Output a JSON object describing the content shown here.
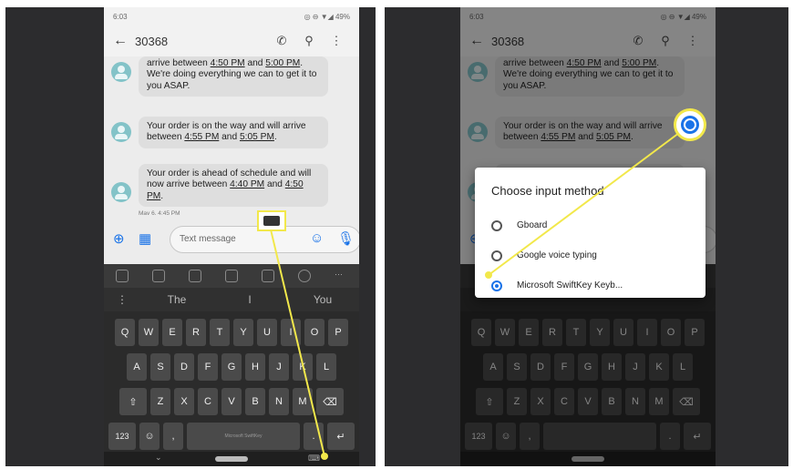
{
  "left": {
    "status": {
      "time": "6:03",
      "battery": "49%"
    },
    "appbar": {
      "title": "30368"
    },
    "messages": [
      {
        "lines": [
          "arrive between ",
          "4:50 PM",
          " and ",
          "5:00 PM",
          ". We're doing everything we can to get it to you ASAP."
        ]
      },
      {
        "lines": [
          "Your order is on the way and will arrive between ",
          "4:55 PM",
          " and ",
          "5:05 PM",
          "."
        ]
      },
      {
        "lines": [
          "Your order is ahead of schedule and will now arrive between ",
          "4:40 PM",
          " and ",
          "4:50 PM",
          "."
        ]
      }
    ],
    "timestamp": "May 6, 4:45 PM",
    "composer": {
      "placeholder": "Text message"
    },
    "suggestions": [
      "The",
      "I",
      "You"
    ],
    "rows": [
      [
        "Q",
        "W",
        "E",
        "R",
        "T",
        "Y",
        "U",
        "I",
        "O",
        "P"
      ],
      [
        "A",
        "S",
        "D",
        "F",
        "G",
        "H",
        "J",
        "K",
        "L"
      ],
      [
        "Z",
        "X",
        "C",
        "V",
        "B",
        "N",
        "M"
      ]
    ],
    "space_label": "Microsoft SwiftKey",
    "num_key": "123"
  },
  "right": {
    "status": {
      "time": "6:03",
      "battery": "49%"
    },
    "appbar": {
      "title": "30368"
    },
    "dialog": {
      "title": "Choose input method",
      "options": [
        {
          "label": "Gboard",
          "selected": false
        },
        {
          "label": "Google voice typing",
          "selected": false
        },
        {
          "label": "Microsoft SwiftKey Keyb...",
          "selected": true
        }
      ]
    }
  },
  "colors": {
    "callout": "#f2e84b",
    "accent": "#1a73e8"
  }
}
